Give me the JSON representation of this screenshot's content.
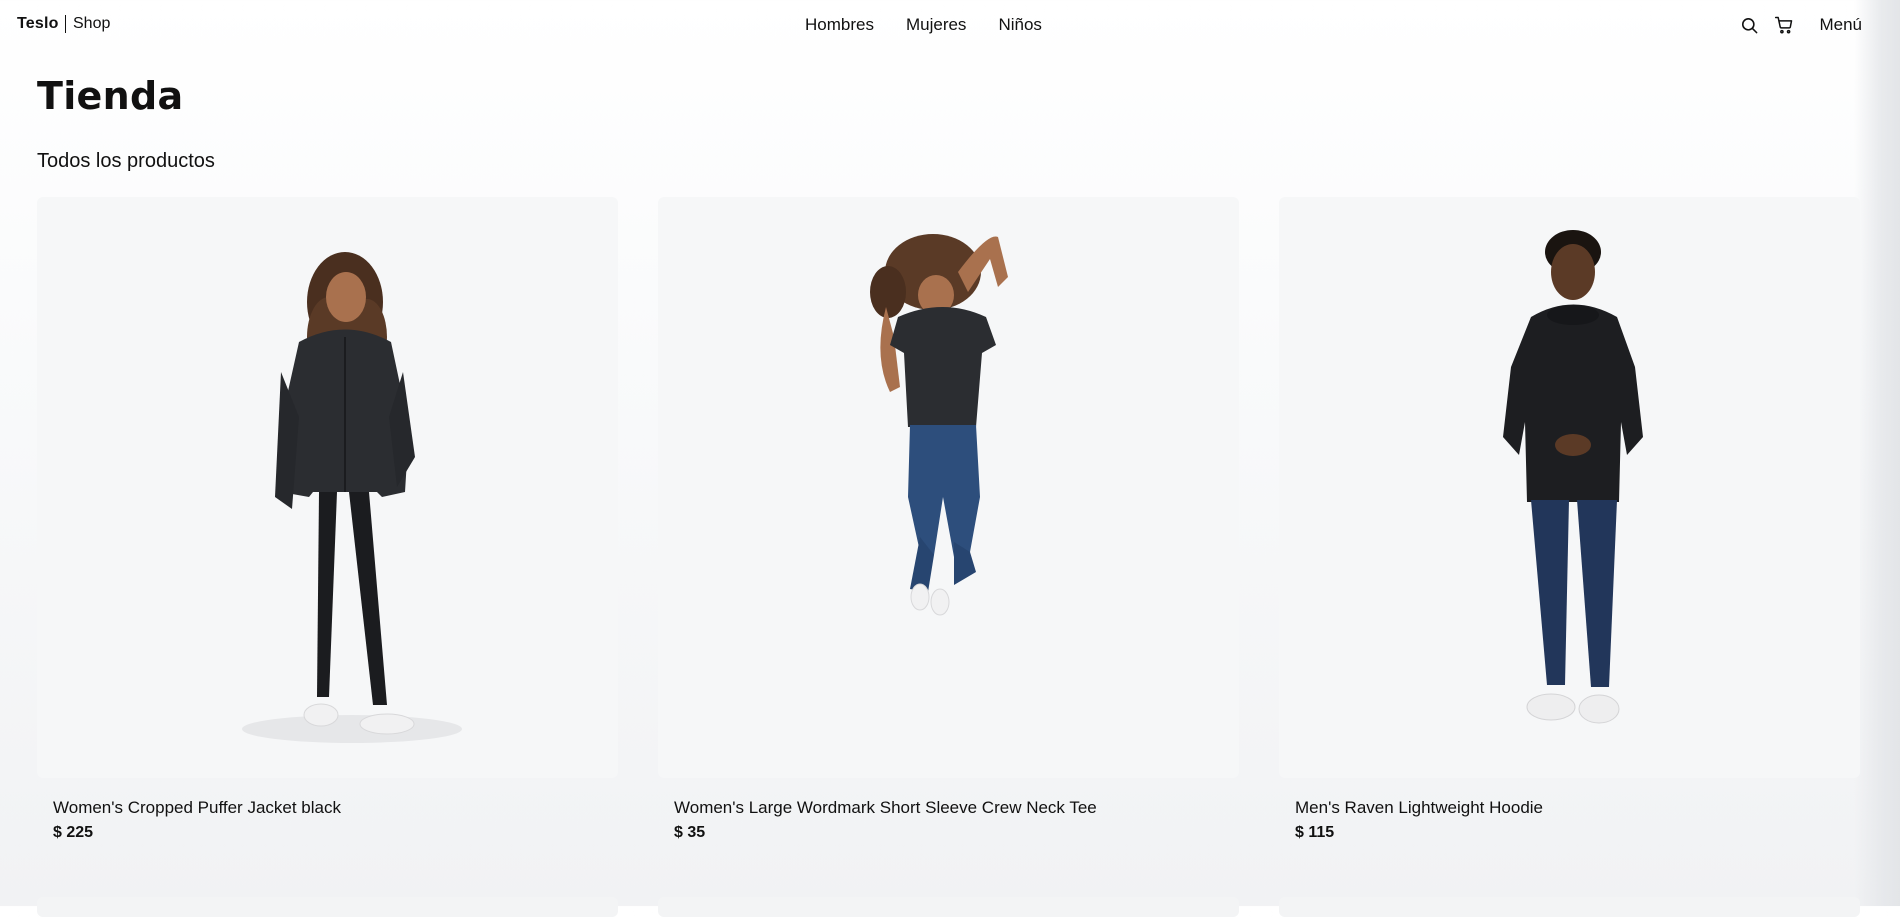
{
  "header": {
    "logo_main": "Teslo",
    "logo_sub": "Shop",
    "nav_links": [
      "Hombres",
      "Mujeres",
      "Niños"
    ],
    "menu_label": "Menú",
    "icons": [
      "search-icon",
      "cart-icon"
    ]
  },
  "main": {
    "title": "Tienda",
    "subtitle": "Todos los productos"
  },
  "products": [
    {
      "title": "Women's Cropped Puffer Jacket black",
      "price": "$ 225",
      "image": "woman-puffer-jacket-photo"
    },
    {
      "title": "Women's Large Wordmark Short Sleeve Crew Neck Tee",
      "price": "$ 35",
      "image": "woman-jumping-tee-photo"
    },
    {
      "title": "Men's Raven Lightweight Hoodie",
      "price": "$ 115",
      "image": "man-hoodie-photo"
    }
  ],
  "colors": {
    "text": "#111111",
    "card_bg": "#f6f7f8",
    "page_bg": "#f9fafb"
  }
}
